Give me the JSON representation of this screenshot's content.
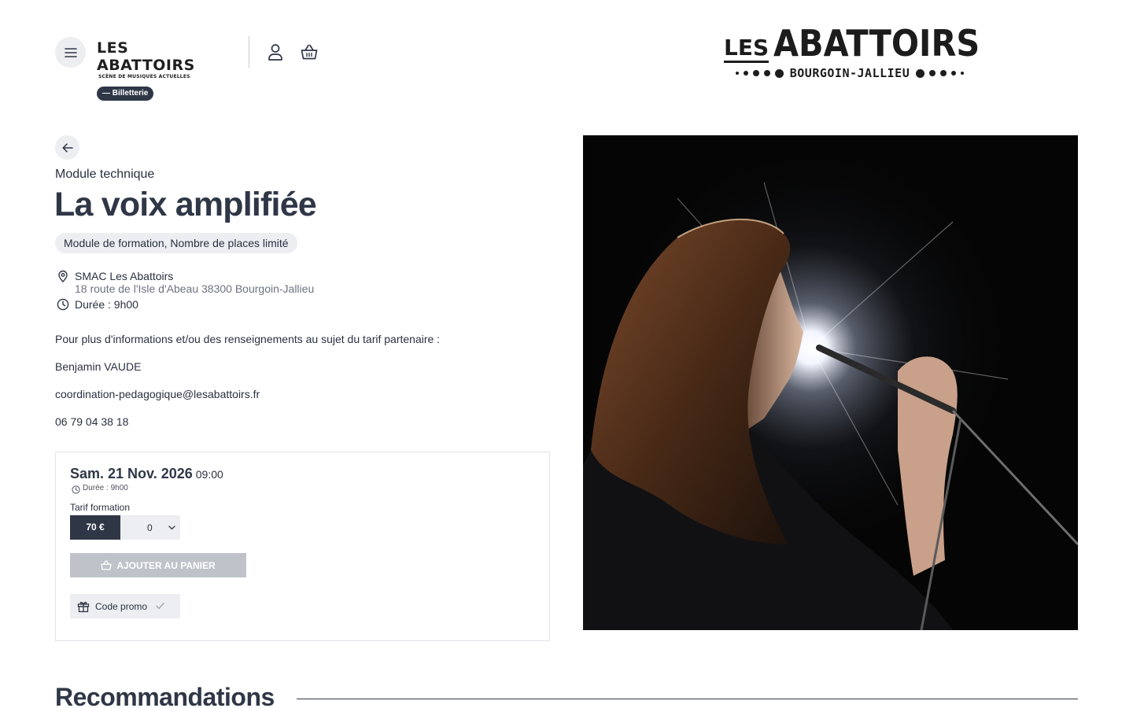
{
  "header": {
    "small_logo_text": "LES ABATTOIRS",
    "small_logo_sub": "SCÈNE DE MUSIQUES ACTUELLES",
    "badge": "— Billetterie",
    "icons": [
      "menu-icon",
      "user-icon",
      "basket-icon"
    ]
  },
  "brand": {
    "les": "LES",
    "name": "ABATTOIRS",
    "city": "BOURGOIN-JALLIEU"
  },
  "event": {
    "category": "Module technique",
    "title": "La voix amplifiée",
    "tags": "Module de formation, Nombre de places limité",
    "venue": "SMAC Les Abattoirs",
    "address": "18 route de l'Isle d'Abeau 38300 Bourgoin-Jallieu",
    "duration": "Durée : 9h00"
  },
  "info": {
    "intro": "Pour plus d'informations et/ou des renseignements au sujet du tarif partenaire :",
    "contact_name": "Benjamin VAUDE",
    "email": "coordination-pedagogique@lesabattoirs.fr",
    "phone": "06 79 04 38 18"
  },
  "booking": {
    "date": "Sam. 21 Nov. 2026",
    "time": "09:00",
    "duration": "Durée : 9h00",
    "tarif_label": "Tarif formation",
    "price": "70 €",
    "quantity": "0",
    "add_to_cart": "AJOUTER AU PANIER",
    "promo": "Code promo"
  },
  "recommendations": {
    "title": "Recommandations"
  },
  "colors": {
    "primary": "#2f3747",
    "pill_bg": "#eceef1",
    "disabled": "#bfc3c9"
  }
}
